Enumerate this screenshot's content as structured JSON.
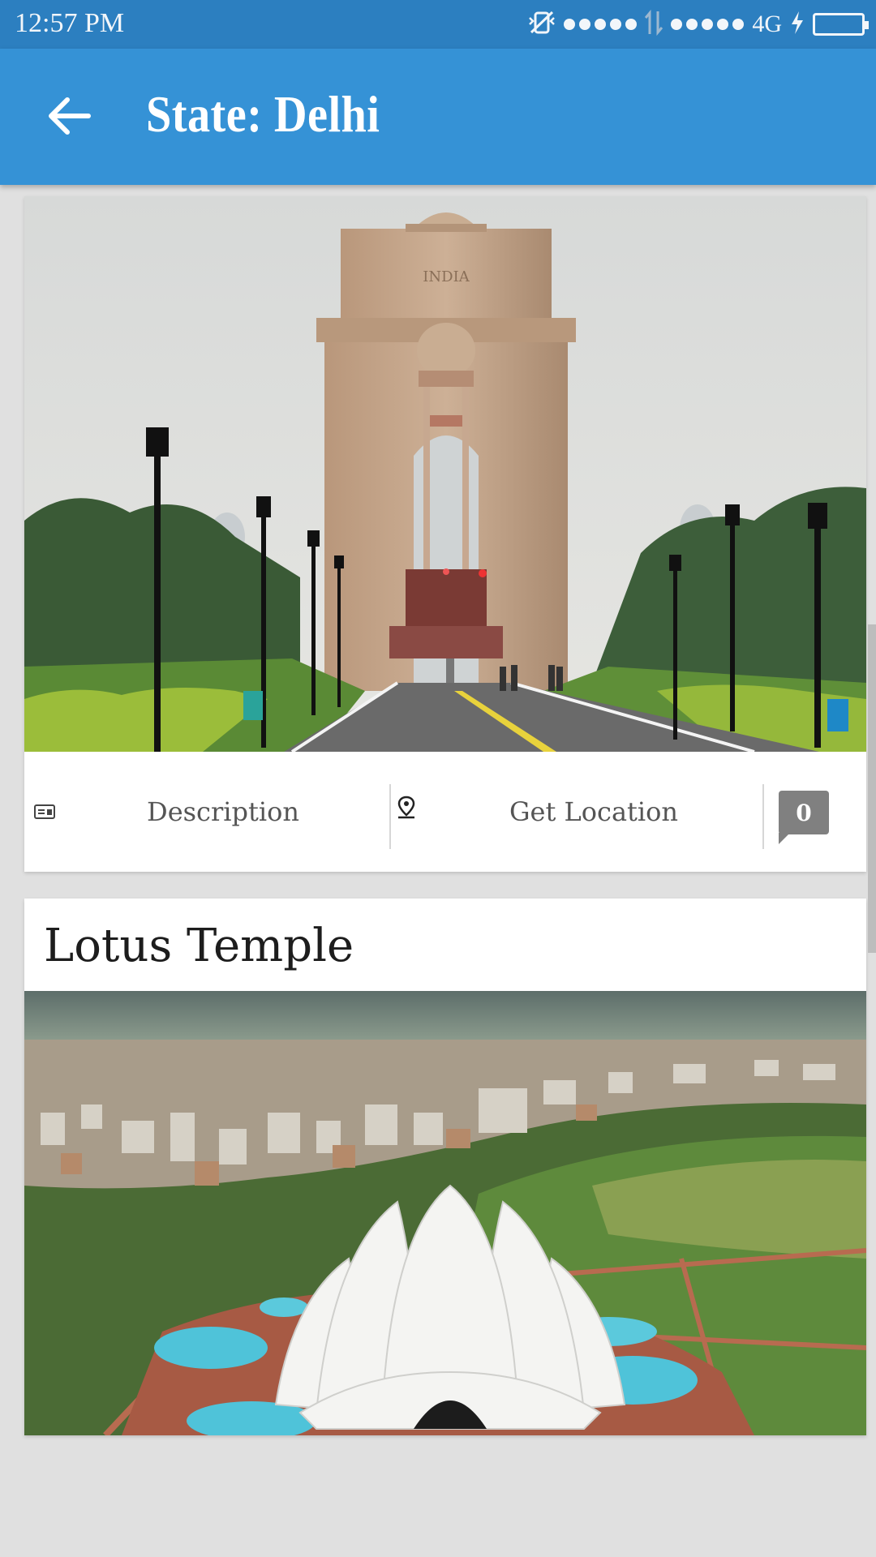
{
  "status_bar": {
    "time": "12:57 PM",
    "network": "4G",
    "icons": [
      "vibrate-off-icon",
      "signal-dots-icon",
      "data-transfer-icon",
      "signal-dots-icon",
      "charging-icon",
      "battery-icon"
    ],
    "battery_level": 1.0,
    "battery_color": "#7ed321"
  },
  "app_bar": {
    "title": "State: Delhi",
    "back_icon": "arrow-left-icon",
    "color": "#3592d6"
  },
  "places": [
    {
      "image": "India Gate photo",
      "actions": {
        "description_label": "Description",
        "location_label": "Get Location",
        "comment_count": "0"
      }
    },
    {
      "title": "Lotus Temple",
      "image": "Lotus Temple aerial photo"
    }
  ]
}
